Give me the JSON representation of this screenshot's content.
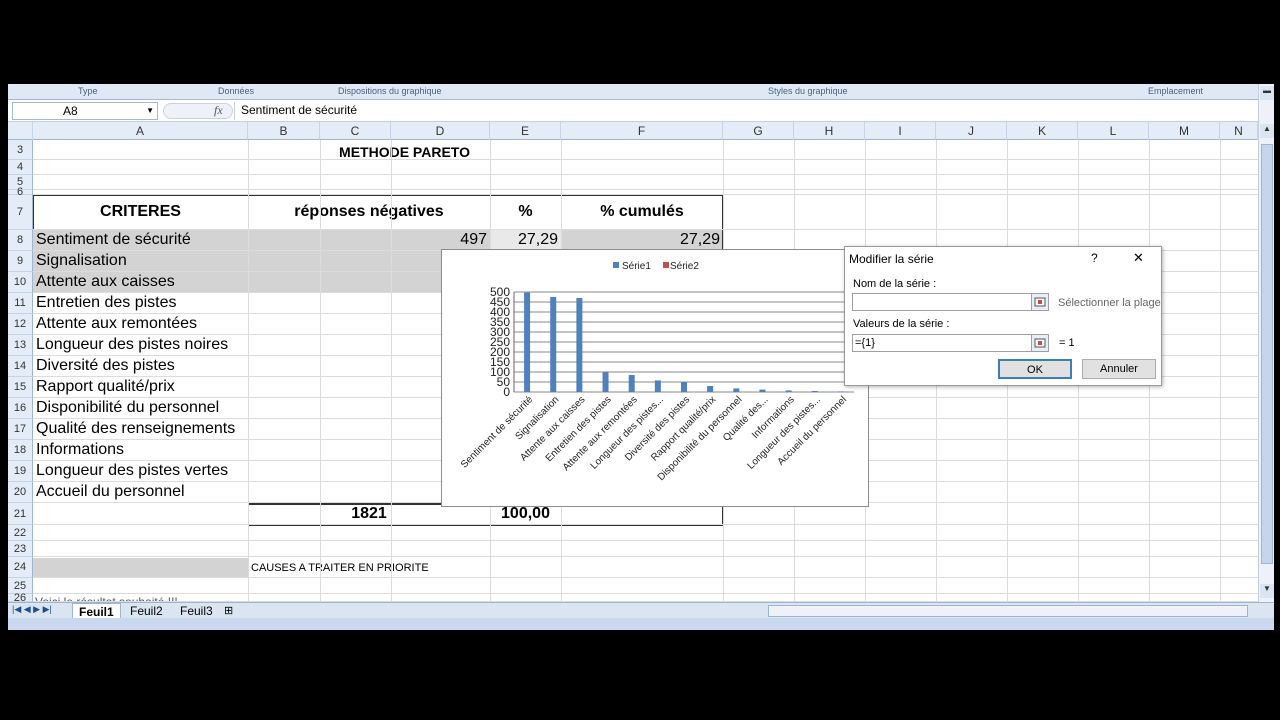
{
  "ribbon_groups": [
    "Type",
    "Données",
    "Dispositions du graphique",
    "Styles du graphique",
    "Emplacement"
  ],
  "name_box": "A8",
  "formula_fx": "fx",
  "formula_value": "Sentiment de sécurité",
  "columns": [
    "A",
    "B",
    "C",
    "D",
    "E",
    "F",
    "G",
    "H",
    "I",
    "J",
    "K",
    "L",
    "M",
    "N"
  ],
  "rows": [
    "3",
    "4",
    "5",
    "6",
    "7",
    "8",
    "9",
    "10",
    "11",
    "12",
    "13",
    "14",
    "15",
    "16",
    "17",
    "18",
    "19",
    "20",
    "21",
    "22",
    "23",
    "24",
    "25",
    "26"
  ],
  "sheet": {
    "title": "METHODE PARETO",
    "header_criteres": "CRITERES",
    "header_reponses": "réponses négatives",
    "header_pct": "%",
    "header_cumul": "% cumulés",
    "criteres": [
      "Sentiment de sécurité",
      "Signalisation",
      "Attente aux caisses",
      "Entretien des pistes",
      "Attente aux remontées",
      "Longueur des pistes noires",
      "Diversité des pistes",
      "Rapport qualité/prix",
      "Disponibilité du personnel",
      "Qualité des renseignements",
      "Informations",
      "Longueur des pistes vertes",
      "Accueil du personnel"
    ],
    "row8_reponses": "497",
    "row8_pct": "27,29",
    "row8_cumul": "27,29",
    "total": "1821",
    "total_pct": "100,00",
    "causes_label": "CAUSES A TRAITER EN PRIORITE",
    "row26_text": "Voici le résultat souhaité !!!"
  },
  "tabs": [
    "Feuil1",
    "Feuil2",
    "Feuil3"
  ],
  "chart_data": {
    "type": "bar",
    "categories": [
      "Sentiment de sécurité",
      "Signalisation",
      "Attente aux caisses",
      "Entretien des pistes",
      "Attente aux remontées",
      "Longueur des pistes...",
      "Diversité des pistes",
      "Rapport qualité/prix",
      "Disponibilité du personnel",
      "Qualité des...",
      "Informations",
      "Longueur des pistes...",
      "Accueil du personnel"
    ],
    "series": [
      {
        "name": "Série1",
        "values": [
          497,
          475,
          470,
          100,
          85,
          58,
          50,
          30,
          18,
          12,
          8,
          5,
          3
        ]
      },
      {
        "name": "Série2",
        "values": []
      }
    ],
    "yticks": [
      "0",
      "50",
      "100",
      "150",
      "200",
      "250",
      "300",
      "350",
      "400",
      "450",
      "500"
    ],
    "ylim": [
      0,
      500
    ],
    "colors": {
      "serie1": "#4f81bd",
      "serie2": "#c0504d"
    },
    "legend": "top"
  },
  "dialog": {
    "title": "Modifier la série",
    "help": "?",
    "close": "✕",
    "nom_label": "Nom de la série :",
    "nom_value": "",
    "select_range": "Sélectionner la plage",
    "valeurs_label": "Valeurs de la série :",
    "valeurs_value": "={1}",
    "valeurs_result": "= 1",
    "ok": "OK",
    "cancel": "Annuler"
  }
}
